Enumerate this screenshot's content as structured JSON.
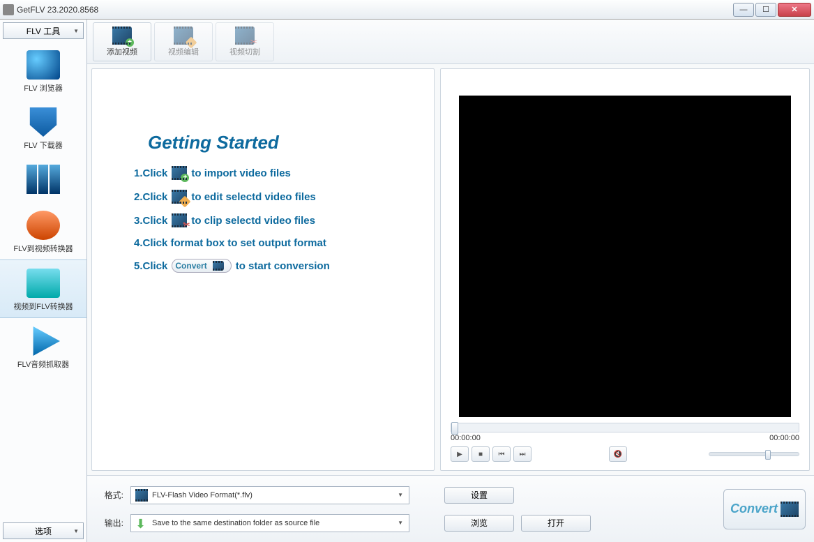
{
  "window": {
    "title": "GetFLV 23.2020.8568"
  },
  "sidebar": {
    "top_dropdown": "FLV 工具",
    "items": [
      {
        "label": "FLV 浏览器"
      },
      {
        "label": "FLV 下载器"
      },
      {
        "label": ""
      },
      {
        "label": "FLV到视频转换器"
      },
      {
        "label": "视频到FLV转换器"
      },
      {
        "label": "FLV音频抓取器"
      }
    ],
    "bottom_dropdown": "选项"
  },
  "toolbar": {
    "add_video": "添加视频",
    "edit_video": "视频编辑",
    "clip_video": "视频切割"
  },
  "getting_started": {
    "title": "Getting Started",
    "step1_pre": "1.Click",
    "step1_post": "to import video files",
    "step2_pre": "2.Click",
    "step2_post": "to edit selectd video files",
    "step3_pre": "3.Click",
    "step3_post": "to clip selectd video files",
    "step4": "4.Click format box to set output format",
    "step5_pre": "5.Click",
    "step5_conv": "Convert",
    "step5_post": "to start conversion"
  },
  "player": {
    "time_current": "00:00:00",
    "time_total": "00:00:00"
  },
  "bottom": {
    "format_label": "格式:",
    "format_value": "FLV-Flash Video Format(*.flv)",
    "output_label": "输出:",
    "output_value": "Save to the same destination folder as source file",
    "settings_btn": "设置",
    "browse_btn": "浏览",
    "open_btn": "打开",
    "convert_btn": "Convert"
  }
}
